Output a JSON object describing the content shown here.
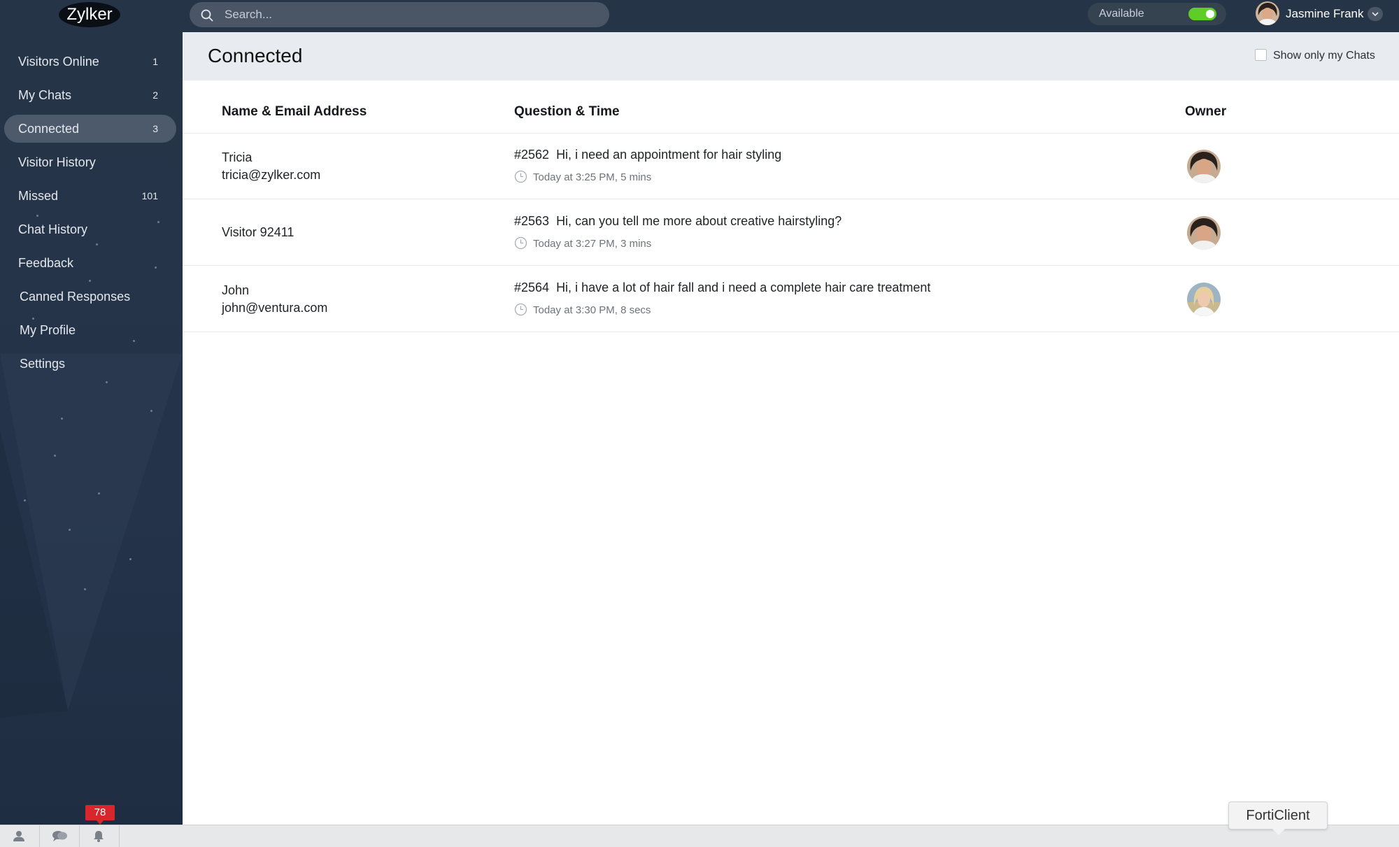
{
  "app": {
    "logo_text": "Zylker"
  },
  "search": {
    "placeholder": "Search..."
  },
  "status": {
    "label": "Available",
    "enabled": true,
    "color": "#5fcd28"
  },
  "user": {
    "name": "Jasmine Frank"
  },
  "sidebar": {
    "items": [
      {
        "label": "Visitors Online",
        "count": "1"
      },
      {
        "label": "My Chats",
        "count": "2"
      },
      {
        "label": "Connected",
        "count": "3",
        "active": true
      },
      {
        "label": "Visitor History",
        "count": ""
      },
      {
        "label": "Missed",
        "count": "101"
      },
      {
        "label": "Chat History",
        "count": ""
      },
      {
        "label": "Feedback",
        "count": ""
      },
      {
        "label": "Canned Responses",
        "count": ""
      },
      {
        "label": "My Profile",
        "count": ""
      },
      {
        "label": "Settings",
        "count": ""
      }
    ]
  },
  "main": {
    "title": "Connected",
    "filter_label": "Show only my Chats",
    "filter_checked": false,
    "columns": {
      "name": "Name & Email Address",
      "question": "Question & Time",
      "owner": "Owner"
    },
    "rows": [
      {
        "name": "Tricia",
        "email": "tricia@zylker.com",
        "id": "#2562",
        "question": "Hi, i need an appointment for hair styling",
        "time": "Today at 3:25 PM, 5 mins",
        "owner_icon": "owner-avatar-dark-hair"
      },
      {
        "name": "Visitor 92411",
        "email": "",
        "id": "#2563",
        "question": "Hi, can you tell me more about creative hairstyling?",
        "time": "Today at 3:27 PM, 3 mins",
        "owner_icon": "owner-avatar-dark-hair"
      },
      {
        "name": "John",
        "email": "john@ventura.com",
        "id": "#2564",
        "question": "Hi, i have a lot of hair fall and i need a complete hair care treatment",
        "time": "Today at 3:30 PM, 8 secs",
        "owner_icon": "owner-avatar-blonde"
      }
    ]
  },
  "bottombar": {
    "buttons": [
      "visitors-icon",
      "chats-icon",
      "notifications-bell-icon"
    ],
    "notification_count": "78",
    "badge_color": "#d8262f"
  },
  "tooltip": {
    "text": "FortiClient"
  }
}
